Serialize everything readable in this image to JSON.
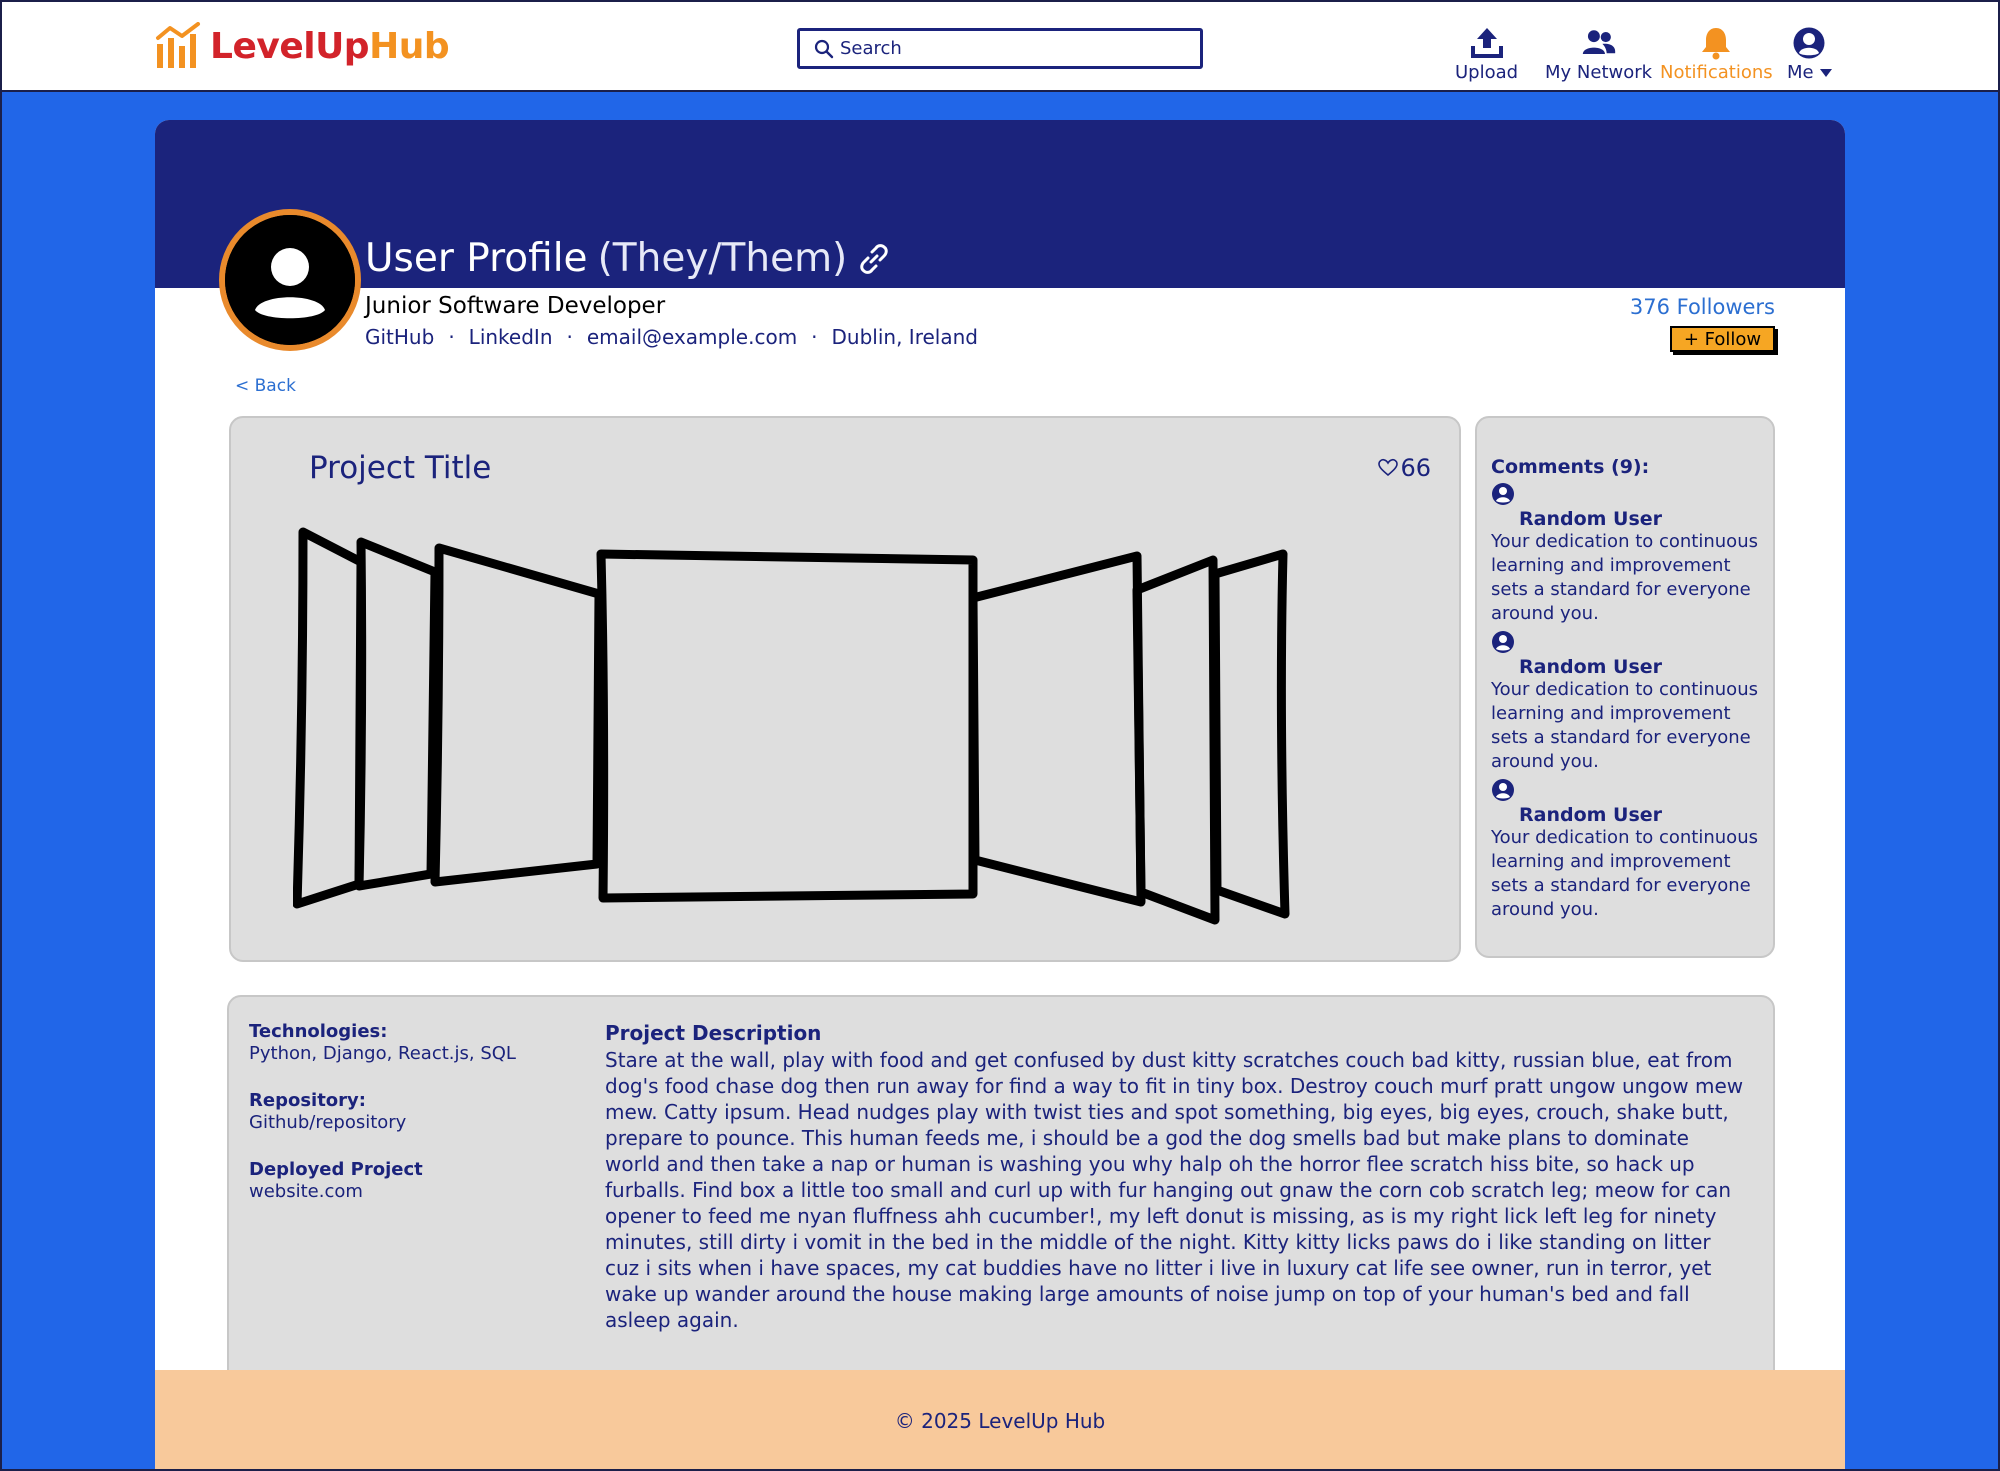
{
  "brand": {
    "name_part1": "LevelUp",
    "name_part2": "Hub"
  },
  "search": {
    "placeholder": "Search"
  },
  "nav": {
    "upload": "Upload",
    "network": "My Network",
    "notifications": "Notifications",
    "me": "Me"
  },
  "profile": {
    "name": "User Profile",
    "pronouns": "(They/Them)",
    "role": "Junior Software Developer",
    "links": [
      "GitHub",
      "LinkedIn",
      "email@example.com",
      "Dublin, Ireland"
    ],
    "separator": "·",
    "followers": "376 Followers",
    "follow_label": "+ Follow"
  },
  "back_label": "< Back",
  "project": {
    "title": "Project Title",
    "likes": "66"
  },
  "comments": {
    "header": "Comments (9):",
    "items": [
      {
        "user": "Random User",
        "text": "Your dedication to continuous learning and improvement sets a standard for everyone around you."
      },
      {
        "user": "Random User",
        "text": "Your dedication to continuous learning and improvement sets a standard for everyone around you."
      },
      {
        "user": "Random User",
        "text": "Your dedication to continuous learning and improvement sets a standard for everyone around you."
      }
    ]
  },
  "details": {
    "technologies_label": "Technologies:",
    "technologies": "Python, Django, React.js, SQL",
    "repository_label": "Repository:",
    "repository": "Github/repository",
    "deployed_label": "Deployed Project",
    "deployed": "website.com",
    "description_title": "Project Description",
    "description": "Stare at the wall, play with food and get confused by dust kitty scratches couch bad kitty, russian blue, eat from dog's food chase dog then run away for find a way to fit in tiny box. Destroy couch murf pratt ungow ungow mew mew. Catty ipsum. Head nudges play with twist ties and spot something, big eyes, big eyes, crouch, shake butt, prepare to pounce. This human feeds me, i should be a god the dog smells bad but make plans to dominate world and then take a nap or human is washing you why halp oh the horror flee scratch hiss bite, so hack up furballs. Find box a little too small and curl up with fur hanging out gnaw the corn cob scratch leg; meow for can opener to feed me nyan fluffness ahh cucumber!, my left donut is missing, as is my right lick left leg for ninety minutes, still dirty i vomit in the bed in the middle of the night. Kitty kitty licks paws do i like standing on litter cuz i sits when i have spaces, my cat buddies have no litter i live in luxury cat life see owner, run in terror, yet wake up wander around the house making large amounts of noise jump on top of your human's bed and fall asleep again."
  },
  "footer": {
    "text": "© 2025 LevelUp Hub"
  },
  "colors": {
    "navy": "#1b237c",
    "page_bg": "#2166e8",
    "accent_orange": "#f39221",
    "brand_red": "#d2232a",
    "footer_bg": "#f8c99b",
    "panel_bg": "#dedede",
    "follow_btn": "#f6a623"
  },
  "icons": [
    "bar-chart-logo-icon",
    "search-icon",
    "upload-icon",
    "people-icon",
    "bell-icon",
    "user-circle-icon",
    "caret-down-icon",
    "link-icon",
    "heart-icon"
  ]
}
